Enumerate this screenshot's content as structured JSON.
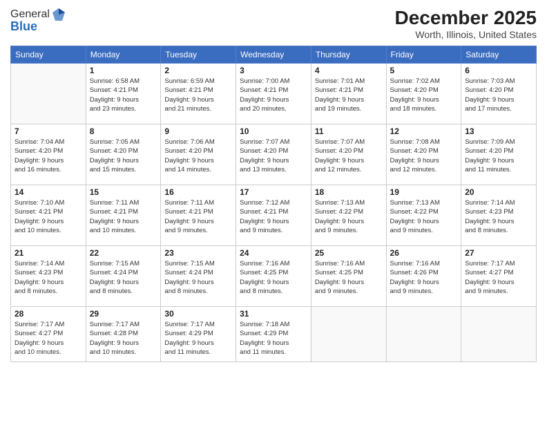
{
  "header": {
    "logo_general": "General",
    "logo_blue": "Blue",
    "month": "December 2025",
    "location": "Worth, Illinois, United States"
  },
  "days_of_week": [
    "Sunday",
    "Monday",
    "Tuesday",
    "Wednesday",
    "Thursday",
    "Friday",
    "Saturday"
  ],
  "weeks": [
    [
      {
        "day": "",
        "info": ""
      },
      {
        "day": "1",
        "info": "Sunrise: 6:58 AM\nSunset: 4:21 PM\nDaylight: 9 hours\nand 23 minutes."
      },
      {
        "day": "2",
        "info": "Sunrise: 6:59 AM\nSunset: 4:21 PM\nDaylight: 9 hours\nand 21 minutes."
      },
      {
        "day": "3",
        "info": "Sunrise: 7:00 AM\nSunset: 4:21 PM\nDaylight: 9 hours\nand 20 minutes."
      },
      {
        "day": "4",
        "info": "Sunrise: 7:01 AM\nSunset: 4:21 PM\nDaylight: 9 hours\nand 19 minutes."
      },
      {
        "day": "5",
        "info": "Sunrise: 7:02 AM\nSunset: 4:20 PM\nDaylight: 9 hours\nand 18 minutes."
      },
      {
        "day": "6",
        "info": "Sunrise: 7:03 AM\nSunset: 4:20 PM\nDaylight: 9 hours\nand 17 minutes."
      }
    ],
    [
      {
        "day": "7",
        "info": "Sunrise: 7:04 AM\nSunset: 4:20 PM\nDaylight: 9 hours\nand 16 minutes."
      },
      {
        "day": "8",
        "info": "Sunrise: 7:05 AM\nSunset: 4:20 PM\nDaylight: 9 hours\nand 15 minutes."
      },
      {
        "day": "9",
        "info": "Sunrise: 7:06 AM\nSunset: 4:20 PM\nDaylight: 9 hours\nand 14 minutes."
      },
      {
        "day": "10",
        "info": "Sunrise: 7:07 AM\nSunset: 4:20 PM\nDaylight: 9 hours\nand 13 minutes."
      },
      {
        "day": "11",
        "info": "Sunrise: 7:07 AM\nSunset: 4:20 PM\nDaylight: 9 hours\nand 12 minutes."
      },
      {
        "day": "12",
        "info": "Sunrise: 7:08 AM\nSunset: 4:20 PM\nDaylight: 9 hours\nand 12 minutes."
      },
      {
        "day": "13",
        "info": "Sunrise: 7:09 AM\nSunset: 4:20 PM\nDaylight: 9 hours\nand 11 minutes."
      }
    ],
    [
      {
        "day": "14",
        "info": "Sunrise: 7:10 AM\nSunset: 4:21 PM\nDaylight: 9 hours\nand 10 minutes."
      },
      {
        "day": "15",
        "info": "Sunrise: 7:11 AM\nSunset: 4:21 PM\nDaylight: 9 hours\nand 10 minutes."
      },
      {
        "day": "16",
        "info": "Sunrise: 7:11 AM\nSunset: 4:21 PM\nDaylight: 9 hours\nand 9 minutes."
      },
      {
        "day": "17",
        "info": "Sunrise: 7:12 AM\nSunset: 4:21 PM\nDaylight: 9 hours\nand 9 minutes."
      },
      {
        "day": "18",
        "info": "Sunrise: 7:13 AM\nSunset: 4:22 PM\nDaylight: 9 hours\nand 9 minutes."
      },
      {
        "day": "19",
        "info": "Sunrise: 7:13 AM\nSunset: 4:22 PM\nDaylight: 9 hours\nand 9 minutes."
      },
      {
        "day": "20",
        "info": "Sunrise: 7:14 AM\nSunset: 4:23 PM\nDaylight: 9 hours\nand 8 minutes."
      }
    ],
    [
      {
        "day": "21",
        "info": "Sunrise: 7:14 AM\nSunset: 4:23 PM\nDaylight: 9 hours\nand 8 minutes."
      },
      {
        "day": "22",
        "info": "Sunrise: 7:15 AM\nSunset: 4:24 PM\nDaylight: 9 hours\nand 8 minutes."
      },
      {
        "day": "23",
        "info": "Sunrise: 7:15 AM\nSunset: 4:24 PM\nDaylight: 9 hours\nand 8 minutes."
      },
      {
        "day": "24",
        "info": "Sunrise: 7:16 AM\nSunset: 4:25 PM\nDaylight: 9 hours\nand 8 minutes."
      },
      {
        "day": "25",
        "info": "Sunrise: 7:16 AM\nSunset: 4:25 PM\nDaylight: 9 hours\nand 9 minutes."
      },
      {
        "day": "26",
        "info": "Sunrise: 7:16 AM\nSunset: 4:26 PM\nDaylight: 9 hours\nand 9 minutes."
      },
      {
        "day": "27",
        "info": "Sunrise: 7:17 AM\nSunset: 4:27 PM\nDaylight: 9 hours\nand 9 minutes."
      }
    ],
    [
      {
        "day": "28",
        "info": "Sunrise: 7:17 AM\nSunset: 4:27 PM\nDaylight: 9 hours\nand 10 minutes."
      },
      {
        "day": "29",
        "info": "Sunrise: 7:17 AM\nSunset: 4:28 PM\nDaylight: 9 hours\nand 10 minutes."
      },
      {
        "day": "30",
        "info": "Sunrise: 7:17 AM\nSunset: 4:29 PM\nDaylight: 9 hours\nand 11 minutes."
      },
      {
        "day": "31",
        "info": "Sunrise: 7:18 AM\nSunset: 4:29 PM\nDaylight: 9 hours\nand 11 minutes."
      },
      {
        "day": "",
        "info": ""
      },
      {
        "day": "",
        "info": ""
      },
      {
        "day": "",
        "info": ""
      }
    ]
  ]
}
